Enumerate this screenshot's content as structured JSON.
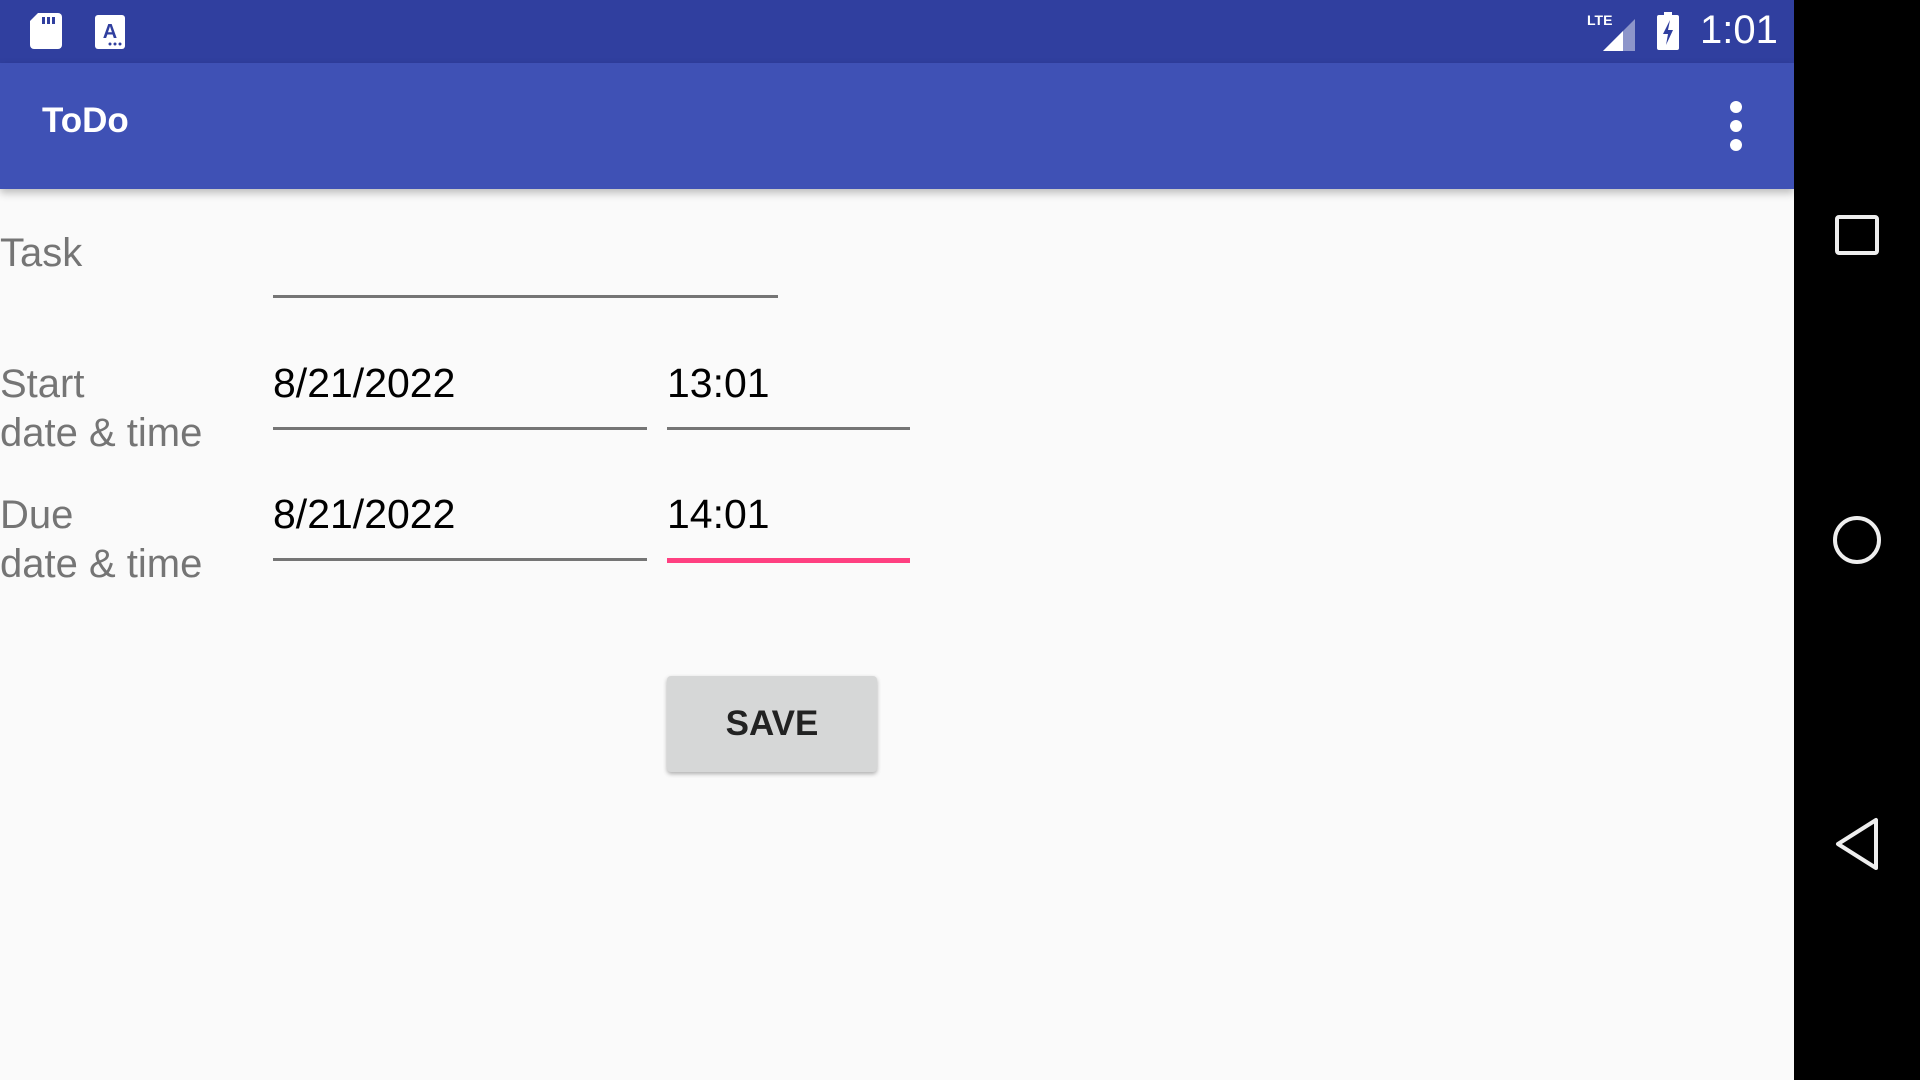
{
  "status_bar": {
    "time": "1:01",
    "icons": [
      "sd-card-icon",
      "notification-a-icon",
      "lte-signal-icon",
      "battery-charging-icon"
    ],
    "background_color": "#303F9F"
  },
  "app_bar": {
    "title": "ToDo",
    "menu_icon": "overflow-menu-icon",
    "background_color": "#3F51B5"
  },
  "form": {
    "task": {
      "label": "Task",
      "value": ""
    },
    "start": {
      "label_line1": "Start",
      "label_line2": "date & time",
      "date": "8/21/2022",
      "time": "13:01"
    },
    "due": {
      "label_line1": "Due",
      "label_line2": "date & time",
      "date": "8/21/2022",
      "time": "14:01",
      "time_focused": true
    },
    "accent_color": "#FF4081"
  },
  "actions": {
    "save_label": "SAVE"
  },
  "nav_bar": {
    "buttons": [
      "recents-icon",
      "home-icon",
      "back-icon"
    ]
  }
}
